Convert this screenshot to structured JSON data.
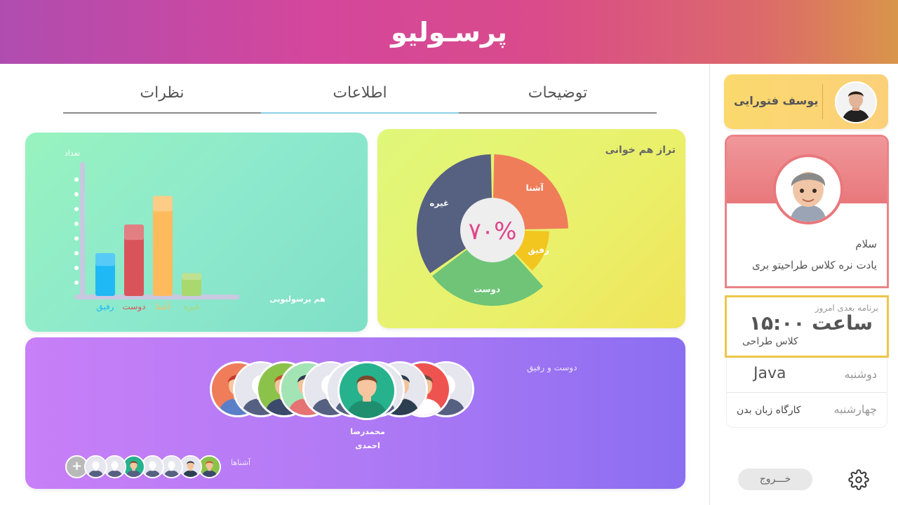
{
  "app": {
    "logo": "پرسـولیو"
  },
  "tabs": [
    {
      "label": "توضیحات"
    },
    {
      "label": "اطلاعات"
    },
    {
      "label": "نظرات"
    }
  ],
  "bar_chart": {
    "ylabel": "تعداد",
    "xlabel": "هم پرسولیویی"
  },
  "pie_chart": {
    "title": "تراز هم خوانی",
    "center_value": "۷۰%"
  },
  "chart_data": [
    {
      "type": "bar",
      "categories": [
        "رفیق",
        "دوست",
        "آشنا",
        "غیره"
      ],
      "values": [
        3,
        5,
        7,
        1.6
      ],
      "category_colors": [
        "#1fb9f5",
        "#d9545a",
        "#fdbb5e",
        "#a9d86e"
      ],
      "xlabel": "هم پرسولیویی",
      "ylabel": "تعداد",
      "ylim": [
        0,
        8
      ]
    },
    {
      "type": "pie",
      "categories": [
        "آشنا",
        "رفیق",
        "دوست",
        "غیره"
      ],
      "values": [
        25,
        13,
        27,
        35
      ],
      "colors": [
        "#ef7d5a",
        "#f2c51f",
        "#6fc478",
        "#566081"
      ],
      "center_label": "۷۰%"
    }
  ],
  "friends": {
    "label": "دوست و رفیق",
    "selected_name_1": "محمدرضا",
    "selected_name_2": "احمدی",
    "acquaintances_label": "آشناها",
    "plus_label": "+"
  },
  "profile": {
    "name": "یوسف فتورایی"
  },
  "greeting": {
    "hello": "سلام",
    "message": "یادت نره کلاس طراحیتو بری"
  },
  "schedule": {
    "label": "برنامه بعدی امروز",
    "time": "ساعت ۱۵:۰۰",
    "class_name": "کلاس طراحی"
  },
  "week": [
    {
      "day": "دوشنبه",
      "course": "Java"
    },
    {
      "day": "چهارشنبه",
      "course": "کارگاه زبان بدن"
    }
  ],
  "footer": {
    "logout_label": "خـــروج"
  },
  "colors": {
    "header_gradient": [
      "#b04cb0",
      "#d4479c",
      "#d9954a"
    ],
    "profile_card": "#fbd96d",
    "schedule_border": "#edc64a",
    "greet_border": "#e98387"
  },
  "icons": {
    "settings": "gear-icon",
    "plus": "plus-icon"
  }
}
